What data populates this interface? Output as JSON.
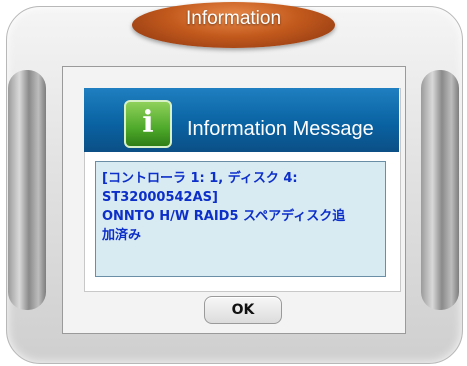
{
  "dialog": {
    "title": "Information",
    "banner_title": "Information Message",
    "message_lines": [
      "[コントローラ 1: 1, ディスク 4:",
      "ST32000542AS]",
      "ONNTO H/W RAID5 スペアディスク追",
      "加済み"
    ],
    "ok_label": "OK"
  },
  "icons": {
    "info": "info-icon"
  },
  "colors": {
    "title_pill": "#c35a1d",
    "banner": "#0a63a3",
    "message_text": "#0d2fc9",
    "message_background": "#d8eaf2",
    "info_icon": "#4ea92a"
  }
}
